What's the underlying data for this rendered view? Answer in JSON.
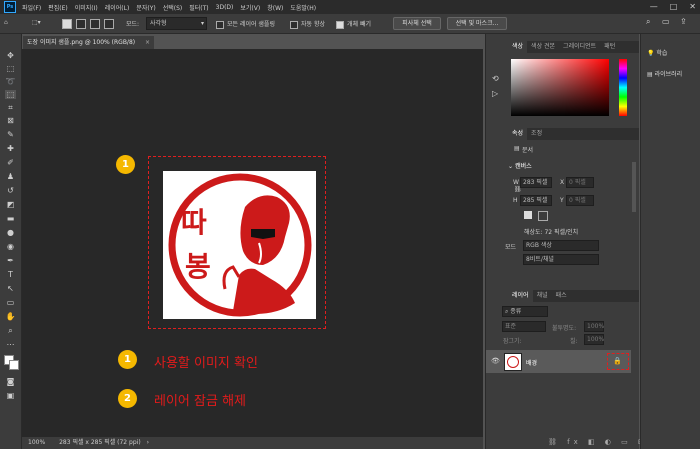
{
  "menu": {
    "items": [
      "파일(F)",
      "편집(E)",
      "이미지(I)",
      "레이어(L)",
      "문자(Y)",
      "선택(S)",
      "필터(T)",
      "3D(D)",
      "보기(V)",
      "창(W)",
      "도움말(H)"
    ]
  },
  "options": {
    "mode_label": "모드:",
    "mode_value": "사각형",
    "sample_all_layers": "모든 레이어 샘플링",
    "auto_enhance": "자동 향상",
    "object_subtract": "개체 빼기",
    "select_subject": "피사체 선택",
    "select_and_mask": "선택 및 마스크..."
  },
  "document": {
    "tab_title": "도장 이미지 샘플.png @ 100% (RGB/8)",
    "stamp_text_top": "따",
    "stamp_text_bottom": "봉",
    "zoom": "100%",
    "dimensions": "283 픽셀 x 285 픽셀 (72 ppi)"
  },
  "annotations": {
    "badge_1": "1",
    "badge_2": "2",
    "item1_label": "사용할 이미지 확인",
    "item2_label": "레이어 잠금 해제"
  },
  "color_panel": {
    "tabs": [
      "색상",
      "색상 견본",
      "그레이디언트",
      "패턴"
    ]
  },
  "properties": {
    "tabs": [
      "속성",
      "조정"
    ],
    "doc_label": "문서",
    "canvas_heading": "캔버스",
    "w_label": "W",
    "w_value": "283 픽셀",
    "h_label": "H",
    "h_value": "285 픽셀",
    "x_label": "X",
    "x_value": "0 픽셀",
    "y_label": "Y",
    "y_value": "0 픽셀",
    "resolution": "해상도: 72 픽셀/인치",
    "mode_label": "모드",
    "mode_value": "RGB 색상",
    "bit_value": "8비트/채널"
  },
  "layers": {
    "tabs": [
      "레이어",
      "채널",
      "패스"
    ],
    "search_placeholder": "종류",
    "blend_mode": "표준",
    "opacity_label": "불투명도:",
    "opacity_value": "100%",
    "lock_label": "잠그기:",
    "fill_label": "칠:",
    "fill_value": "100%",
    "layer_name": "배경"
  },
  "far_panel": {
    "learn": "학습",
    "libraries": "라이브러리"
  },
  "colors": {
    "stamp_red": "#cc1a1a",
    "annotation_red": "#e31b1b",
    "badge_yellow": "#f5b800"
  }
}
